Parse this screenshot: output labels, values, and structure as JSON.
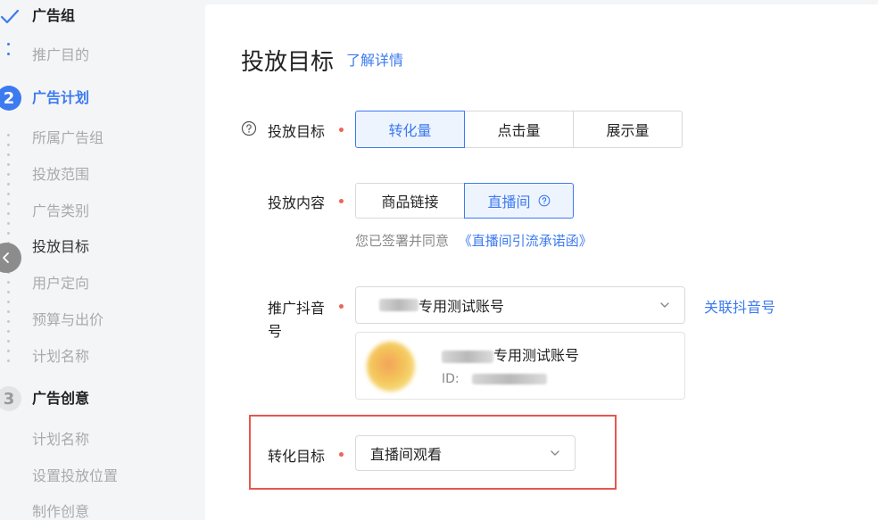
{
  "sidebar": {
    "group_step": {
      "label": "广告组",
      "status": "done"
    },
    "group_items": [
      {
        "label": "推广目的"
      }
    ],
    "plan_step": {
      "number": "2",
      "label": "广告计划"
    },
    "plan_items": [
      {
        "label": "所属广告组"
      },
      {
        "label": "投放范围"
      },
      {
        "label": "广告类别"
      },
      {
        "label": "投放目标"
      },
      {
        "label": "用户定向"
      },
      {
        "label": "预算与出价"
      },
      {
        "label": "计划名称"
      }
    ],
    "creative_step": {
      "number": "3",
      "label": "广告创意"
    },
    "creative_items": [
      {
        "label": "计划名称"
      },
      {
        "label": "设置投放位置"
      },
      {
        "label": "制作创意"
      }
    ]
  },
  "main": {
    "title": "投放目标",
    "learn_more": "了解详情",
    "goal": {
      "label": "投放目标",
      "options": [
        "转化量",
        "点击量",
        "展示量"
      ],
      "selected": "转化量"
    },
    "content": {
      "label": "投放内容",
      "options": [
        "商品链接",
        "直播间"
      ],
      "selected": "直播间",
      "agreement_prefix": "您已签署并同意",
      "agreement_link": "《直播间引流承诺函》"
    },
    "account": {
      "label_line1": "推广抖音",
      "label_line2": "号",
      "select_value": "专用测试账号",
      "link_label": "关联抖音号",
      "card_name": "专用测试账号",
      "card_id_label": "ID:"
    },
    "conversion": {
      "label": "转化目标",
      "value": "直播间观看"
    }
  },
  "colors": {
    "accent": "#3c7af0",
    "required_dot": "#f0635a",
    "highlight_border": "#e5584c"
  }
}
